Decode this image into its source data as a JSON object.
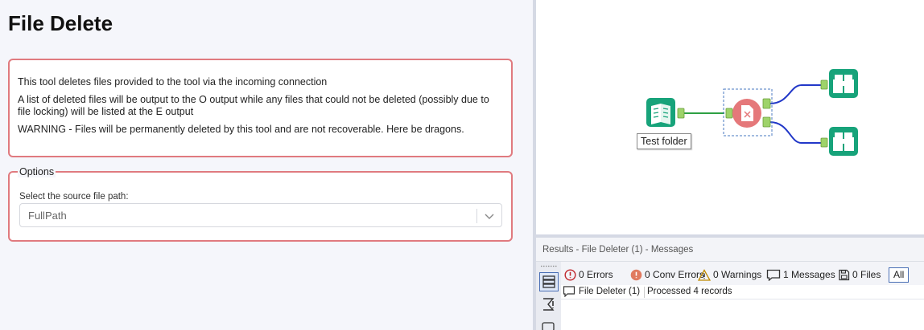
{
  "config": {
    "title": "File Delete",
    "description": [
      "This tool deletes files provided to the tool via the incoming connection",
      "A list of deleted files will be output to the O output while any files that could not be deleted (possibly due to file locking) will be listed at the E output",
      "WARNING - Files will be permanently deleted by this tool and are not recoverable. Here be dragons."
    ],
    "options": {
      "legend": "Options",
      "source_label": "Select the source file path:",
      "source_value": "FullPath"
    }
  },
  "canvas": {
    "input_label": "Test folder",
    "anchors": {
      "input": "I",
      "output_o": "O",
      "output_e": "E"
    },
    "colors": {
      "tool_green": "#17a37a",
      "delete_tool": "#e5787a",
      "connection_green": "#2ea043",
      "connection_blue": "#2238c8"
    }
  },
  "results": {
    "title": "Results - File Deleter (1) - Messages",
    "filters": {
      "errors": "0 Errors",
      "conv_errors": "0 Conv Errors",
      "warnings": "0 Warnings",
      "messages": "1 Messages",
      "files": "0 Files",
      "all": "All"
    },
    "rows": [
      {
        "tool": "File Deleter (1)",
        "message": "Processed 4 records"
      }
    ]
  }
}
